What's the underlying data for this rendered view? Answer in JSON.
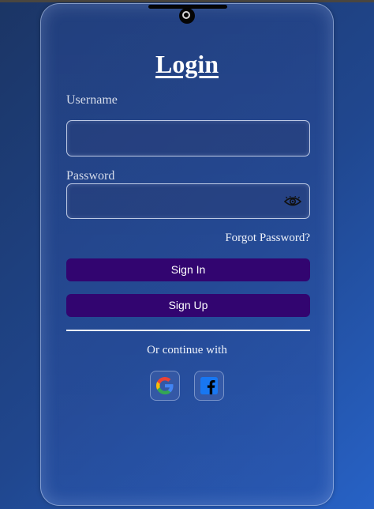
{
  "form": {
    "title": "Login",
    "username_label": "Username",
    "username_value": "",
    "password_label": "Password",
    "password_value": "",
    "forgot_password": "Forgot Password?",
    "sign_in_label": "Sign In",
    "sign_up_label": "Sign Up",
    "continue_with": "Or continue with"
  },
  "social": {
    "google_icon": "google-icon",
    "facebook_icon": "facebook-icon"
  },
  "colors": {
    "button_bg": "#320570",
    "facebook_blue": "#1877f2"
  }
}
